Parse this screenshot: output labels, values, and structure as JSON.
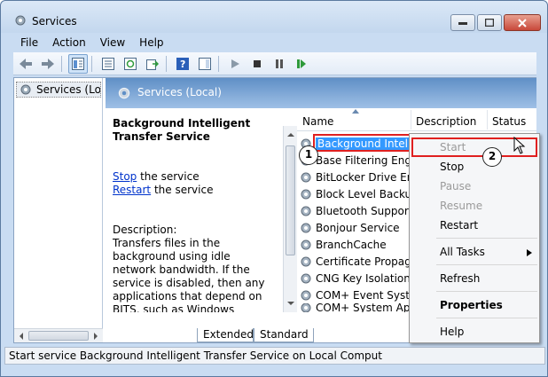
{
  "window": {
    "title": "Services"
  },
  "menu": [
    "File",
    "Action",
    "View",
    "Help"
  ],
  "tree": {
    "item": "Services (Local)"
  },
  "header": {
    "title": "Services (Local)"
  },
  "detail": {
    "service_name": "Background Intelligent Transfer Service",
    "stop_link": "Stop",
    "stop_rest": " the service",
    "restart_link": "Restart",
    "restart_rest": " the service",
    "desc_label": "Description:",
    "description": "Transfers files in the background using idle network bandwidth. If the service is disabled, then any applications that depend on BITS, such as Windows Update or MSN Explorer, will be unable to automatically download programs and other information."
  },
  "list": {
    "columns": [
      "Name",
      "Description",
      "Status"
    ],
    "rows": [
      "Background Intelli...",
      "Base Filtering Engi...",
      "BitLocker Drive En...",
      "Block Level Backu...",
      "Bluetooth Support...",
      "Bonjour Service",
      "BranchCache",
      "Certificate Propag...",
      "CNG Key Isolation",
      "COM+ Event Syst...",
      "COM+ System Ap..."
    ]
  },
  "tabs": [
    "Extended",
    "Standard"
  ],
  "context_menu": {
    "start": "Start",
    "stop": "Stop",
    "pause": "Pause",
    "resume": "Resume",
    "restart": "Restart",
    "all_tasks": "All Tasks",
    "refresh": "Refresh",
    "properties": "Properties",
    "help": "Help"
  },
  "badges": [
    "1",
    "2"
  ],
  "statusbar": {
    "text": "Start service Background Intelligent Transfer Service on Local Comput"
  },
  "colors": {
    "selection": "#3399ff",
    "highlight": "#e02020",
    "header": "#5f8fc6"
  }
}
